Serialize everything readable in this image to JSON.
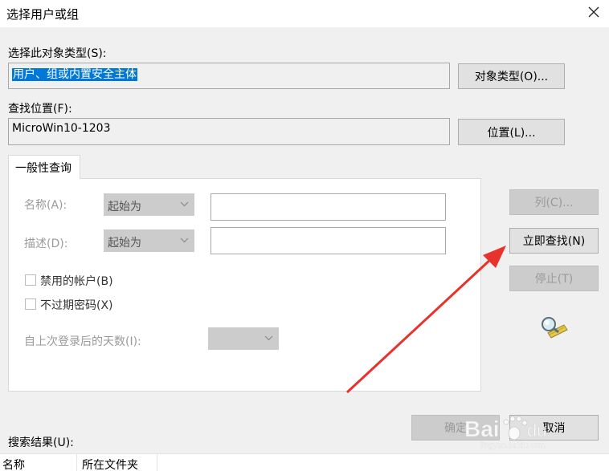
{
  "window": {
    "title": "选择用户或组"
  },
  "object_type": {
    "label": "选择此对象类型(S):",
    "value": "用户、组或内置安全主体",
    "button": "对象类型(O)..."
  },
  "location": {
    "label": "查找位置(F):",
    "value": "MicroWin10-1203",
    "button": "位置(L)..."
  },
  "tab": {
    "label": "一般性查询"
  },
  "query": {
    "name_label": "名称(A):",
    "name_mode": "起始为",
    "desc_label": "描述(D):",
    "desc_mode": "起始为",
    "disabled_accounts": "禁用的帐户(B)",
    "non_expiring_pwd": "不过期密码(X)",
    "days_label": "自上次登录后的天数(I):"
  },
  "side_buttons": {
    "columns": "列(C)...",
    "find_now": "立即查找(N)",
    "stop": "停止(T)"
  },
  "footer": {
    "ok": "确定",
    "cancel": "取消",
    "results_label": "搜索结果(U):"
  },
  "results_table": {
    "columns": [
      "名称",
      "所在文件夹"
    ]
  },
  "watermark": {
    "brand": "Bai",
    "brand_cn": "du",
    "sub": "jingyan.baidu.com"
  },
  "colors": {
    "selection": "#0078d7",
    "arrow": "#e8322c"
  },
  "icons": [
    "close-icon",
    "chevron-down-icon",
    "search-people-icon",
    "annotation-arrow"
  ]
}
